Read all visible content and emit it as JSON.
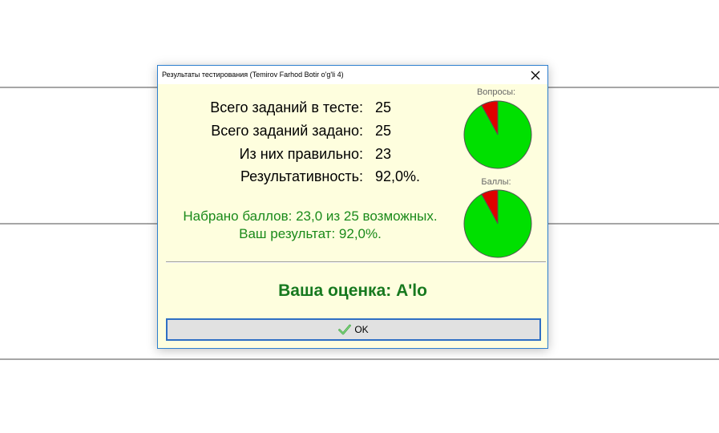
{
  "window": {
    "title": "Результаты тестирования (Temirov Farhod Botir o'g'li 4)"
  },
  "stats": [
    {
      "label": "Всего заданий в тесте:",
      "value": "25"
    },
    {
      "label": "Всего заданий задано:",
      "value": "25"
    },
    {
      "label": "Из них правильно:",
      "value": "23"
    },
    {
      "label": "Результативность:",
      "value": "92,0%."
    }
  ],
  "summary": {
    "points_line": "Набрано баллов: 23,0 из 25 возможных.",
    "result_line": "Ваш результат: 92,0%."
  },
  "grade": {
    "text": "Ваша оценка: A'lo"
  },
  "pies": {
    "questions": {
      "caption": "Вопросы:",
      "correct": 23,
      "total": 25
    },
    "points": {
      "caption": "Баллы:",
      "correct": 23.0,
      "total": 25
    }
  },
  "ok_button": {
    "label": "OK",
    "icon": "checkmark-icon"
  },
  "colors": {
    "correct": "#00e000",
    "wrong": "#e00000",
    "dialog_bg": "#fefede",
    "green_text": "#1a8a1a",
    "grade_text": "#17791f",
    "border_accent": "#2d7fcf"
  }
}
